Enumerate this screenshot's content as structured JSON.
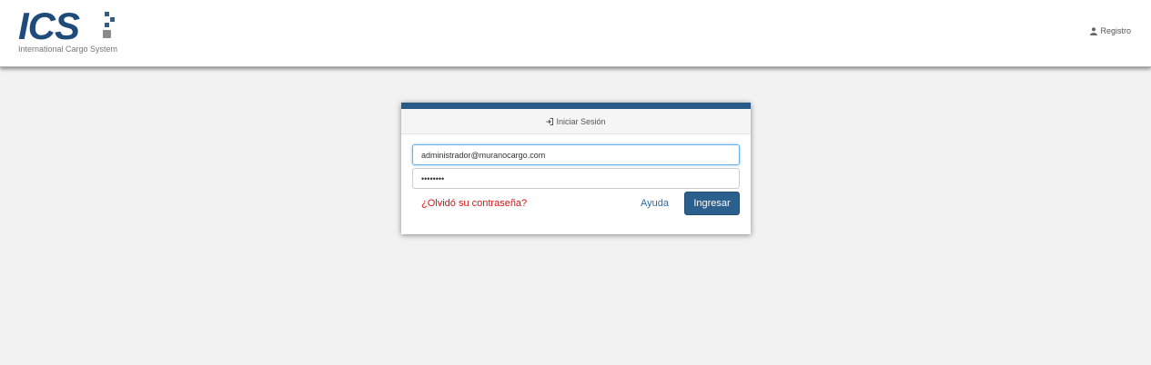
{
  "brand": {
    "logo_text": "ICS",
    "tagline": "International Cargo System",
    "primary_color": "#1f4b7a",
    "accent_color": "#275a87"
  },
  "nav": {
    "register_label": "Registro",
    "register_icon": "user-icon"
  },
  "login": {
    "heading": "Iniciar Sesión",
    "heading_icon": "sign-in-icon",
    "email_value": "administrador@muranocargo.com",
    "password_value": "••••••••",
    "forgot_label": "¿Olvidó su contraseña?",
    "help_label": "Ayuda",
    "submit_label": "Ingresar",
    "forgot_color": "#d81414",
    "button_color": "#2b5f8e"
  }
}
